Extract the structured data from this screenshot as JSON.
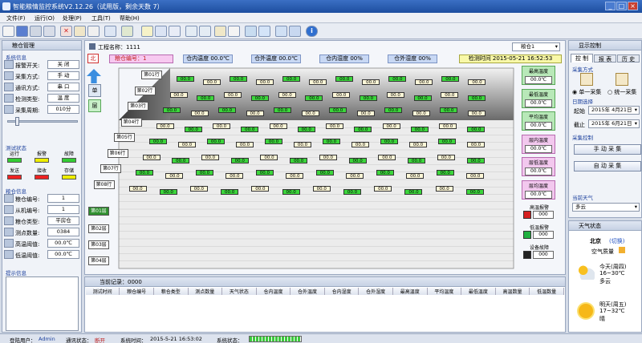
{
  "app": {
    "title": "智能粮情监控系统V2.12.26（试用版，剩余天数 7）"
  },
  "menu": [
    "文件(F)",
    "运行(O)",
    "处理(P)",
    "工具(T)",
    "帮助(H)"
  ],
  "left": {
    "title": "粮仓管理",
    "sys_section": "系统信息",
    "sys_rows": [
      {
        "label": "报警开关:",
        "value": "关 闭"
      },
      {
        "label": "采集方式:",
        "value": "手 动"
      },
      {
        "label": "通讯方式:",
        "value": "串 口"
      },
      {
        "label": "检测类型:",
        "value": "温 度"
      },
      {
        "label": "采集周期:",
        "value": "010分"
      }
    ],
    "test_section": "测试状态",
    "lamps": [
      {
        "label": "运行",
        "color": "#3c3"
      },
      {
        "label": "报警",
        "color": "#ee0"
      },
      {
        "label": "故障",
        "color": "#3c3"
      },
      {
        "label": "发送",
        "color": "#e22"
      },
      {
        "label": "接收",
        "color": "#e22"
      },
      {
        "label": "存储",
        "color": "#ee0"
      }
    ],
    "grain_section": "粮仓信息",
    "grain_rows": [
      {
        "label": "粮仓编号:",
        "value": "1"
      },
      {
        "label": "从机编号:",
        "value": "1"
      },
      {
        "label": "粮仓类型:",
        "value": "平房仓"
      },
      {
        "label": "测点数量:",
        "value": "0384"
      },
      {
        "label": "高温阈值:",
        "value": "00.0℃"
      },
      {
        "label": "低温阈值:",
        "value": "00.0℃"
      }
    ],
    "tip_section": "提示信息"
  },
  "main": {
    "project_label": "工程名称：1111",
    "silo_select": "粮仓1",
    "north": "北",
    "silo_no": "粮仓编号：1",
    "tin": "仓内温度 00.0℃",
    "tout": "仓外温度 00.0℃",
    "hin": "仓内湿度 00%",
    "hout": "仓外湿度 00%",
    "check_time": "检测时间 2015-05-21 16:52:53",
    "side_btns": [
      "单",
      "层"
    ],
    "row_labels": [
      "第01行",
      "第02行",
      "第03行",
      "第04行",
      "第05行",
      "第06行",
      "第07行",
      "第08行"
    ],
    "col_labels": [
      "第01层",
      "第02层",
      "第03层",
      "第04层"
    ],
    "cell_value": "00.0",
    "stats": [
      {
        "label": "最高温度",
        "value": "00.0℃",
        "pink": false
      },
      {
        "label": "最低温度",
        "value": "00.0℃",
        "pink": false
      },
      {
        "label": "平均温度",
        "value": "00.0℃",
        "pink": false
      },
      {
        "label": "层内温度",
        "value": "00.0℃",
        "pink": true
      },
      {
        "label": "层低温度",
        "value": "00.0℃",
        "pink": true
      },
      {
        "label": "层均温度",
        "value": "00.0℃",
        "pink": true
      }
    ],
    "alarms": [
      {
        "label": "高温报警",
        "value": "000",
        "color": "#d42020"
      },
      {
        "label": "低温报警",
        "value": "000",
        "color": "#20b040"
      },
      {
        "label": "设备故障",
        "value": "000",
        "color": "#222"
      }
    ]
  },
  "records": {
    "title": "当前记录：0000",
    "columns": [
      "测试时间",
      "粮仓编号",
      "粮仓类型",
      "测点数量",
      "天气状态",
      "仓内温度",
      "仓外温度",
      "仓内湿度",
      "仓外湿度",
      "最高温度",
      "平均温度",
      "最低温度",
      "高温数量",
      "低温数量"
    ]
  },
  "right": {
    "title": "显示控制",
    "tabs": [
      "控 制",
      "报 表",
      "历 史"
    ],
    "mode_section": "采集方式",
    "mode1": "单一采集",
    "mode2": "统一采集",
    "date_section": "日期选择",
    "start_label": "起始",
    "start_date": "2015年 4月21日",
    "end_label": "截止",
    "end_date": "2015年 6月21日",
    "collect_section": "采集控制",
    "manual_btn": "手 动 采 集",
    "auto_btn": "自 动 采 集",
    "weather_section": "当前天气",
    "weather_select": "多云",
    "weather_title": "天气状态",
    "city": "北京",
    "city_tag": "(切换)",
    "aqi": "空气质量",
    "today": "今天(周四)",
    "today_temp": "16~30℃",
    "today_desc": "多云",
    "tomorrow": "明天(周五)",
    "tomorrow_temp": "17~32℃",
    "tomorrow_desc": "晴"
  },
  "status": {
    "user": "登陆用户：",
    "user_val": "Admin",
    "comm": "通讯状态：",
    "comm_val": "断开",
    "time_label": "系统时间：",
    "time_val": "2015-5-21 16:53:02",
    "sys_label": "系统状态："
  }
}
